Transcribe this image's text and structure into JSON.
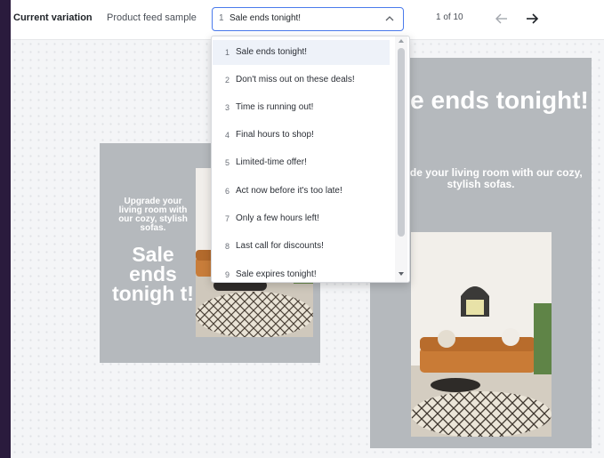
{
  "toolbar": {
    "current_variation_label": "Current variation",
    "product_feed_label": "Product feed sample",
    "select": {
      "number": "1",
      "value": "Sale ends tonight!"
    },
    "pager": "1 of 10",
    "icons": [
      "chevron-up-icon",
      "arrow-left-icon",
      "arrow-right-icon"
    ]
  },
  "dropdown": {
    "options": [
      {
        "number": "1",
        "text": "Sale ends tonight!"
      },
      {
        "number": "2",
        "text": "Don't miss out on these deals!"
      },
      {
        "number": "3",
        "text": "Time is running out!"
      },
      {
        "number": "4",
        "text": "Final hours to shop!"
      },
      {
        "number": "5",
        "text": "Limited-time offer!"
      },
      {
        "number": "6",
        "text": "Act now before it's too late!"
      },
      {
        "number": "7",
        "text": "Only a few hours left!"
      },
      {
        "number": "8",
        "text": "Last call for discounts!"
      },
      {
        "number": "9",
        "text": "Sale expires tonight!"
      }
    ],
    "selected_index": 0
  },
  "previews": {
    "left": {
      "subtitle": "Upgrade your living room with our cozy, stylish sofas.",
      "title": "Sale ends tonigh t!"
    },
    "right": {
      "title": "Sale ends tonight!",
      "subtitle": "Upgrade your living room with our cozy, stylish sofas."
    }
  },
  "colors": {
    "accent": "#4b7bec",
    "card": "#b5b9bd",
    "frame": "#2a1b3d"
  }
}
